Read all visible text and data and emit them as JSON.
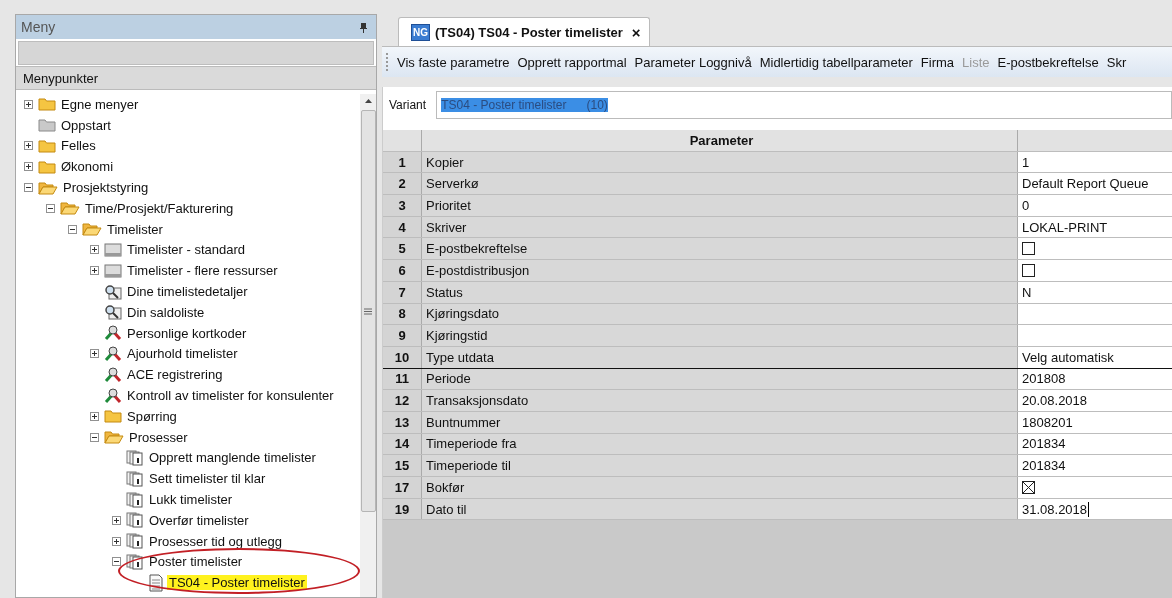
{
  "menu_panel": {
    "title": "Meny",
    "section_title": "Menypunkter"
  },
  "tree": [
    {
      "label": "Egne menyer",
      "kind": "folder",
      "expanded": false,
      "selected": false
    },
    {
      "label": "Oppstart",
      "kind": "folder-grey",
      "selected": false
    },
    {
      "label": "Felles",
      "kind": "folder",
      "expanded": false,
      "selected": false
    },
    {
      "label": "Økonomi",
      "kind": "folder",
      "expanded": false,
      "selected": false
    },
    {
      "label": "Prosjektstyring",
      "kind": "folder-open",
      "expanded": true,
      "selected": false,
      "children": [
        {
          "label": "Time/Prosjekt/Fakturering",
          "kind": "folder-open",
          "expanded": true,
          "selected": false,
          "children": [
            {
              "label": "Timelister",
              "kind": "folder-open",
              "expanded": true,
              "selected": false,
              "children": [
                {
                  "label": "Timelister - standard",
                  "kind": "report",
                  "expanded": false,
                  "selected": false
                },
                {
                  "label": "Timelister - flere ressurser",
                  "kind": "report",
                  "expanded": false,
                  "selected": false
                },
                {
                  "label": "Dine timelistedetaljer",
                  "kind": "search",
                  "selected": false
                },
                {
                  "label": "Din saldoliste",
                  "kind": "search",
                  "selected": false
                },
                {
                  "label": "Personlige kortkoder",
                  "kind": "tools",
                  "selected": false
                },
                {
                  "label": "Ajourhold timelister",
                  "kind": "tools",
                  "expanded": false,
                  "selected": false
                },
                {
                  "label": "ACE registrering",
                  "kind": "tools",
                  "selected": false
                },
                {
                  "label": "Kontroll av timelister for konsulenter",
                  "kind": "tools",
                  "selected": false
                },
                {
                  "label": "Spørring",
                  "kind": "folder",
                  "expanded": false,
                  "selected": false
                },
                {
                  "label": "Prosesser",
                  "kind": "folder-open",
                  "expanded": true,
                  "selected": false,
                  "children": [
                    {
                      "label": "Opprett manglende timelister",
                      "kind": "process",
                      "selected": false
                    },
                    {
                      "label": "Sett timelister til klar",
                      "kind": "process",
                      "selected": false
                    },
                    {
                      "label": "Lukk timelister",
                      "kind": "process",
                      "selected": false
                    },
                    {
                      "label": "Overfør timelister",
                      "kind": "process",
                      "expanded": false,
                      "selected": false
                    },
                    {
                      "label": "Prosesser tid og utlegg",
                      "kind": "process",
                      "expanded": false,
                      "selected": false
                    },
                    {
                      "label": "Poster timelister",
                      "kind": "process",
                      "expanded": true,
                      "selected": false,
                      "children": [
                        {
                          "label": "TS04 - Poster timelister",
                          "kind": "document",
                          "selected": true
                        }
                      ]
                    }
                  ]
                }
              ]
            }
          ]
        }
      ]
    }
  ],
  "tab": {
    "badge": "NG",
    "title": "(TS04) TS04 - Poster timelister",
    "close": "×",
    "selected": true
  },
  "toolbar": [
    {
      "label": "Vis faste parametre",
      "disabled": false
    },
    {
      "label": "Opprett rapportmal",
      "disabled": false
    },
    {
      "label": "Parameter Loggnivå",
      "disabled": false
    },
    {
      "label": "Midlertidig tabellparameter",
      "disabled": false
    },
    {
      "label": "Firma",
      "disabled": false
    },
    {
      "label": "Liste",
      "disabled": true
    },
    {
      "label": "E-postbekreftelse",
      "disabled": false
    },
    {
      "label": "Skr",
      "disabled": false
    }
  ],
  "variant": {
    "label": "Variant",
    "value": "TS04 - Poster timelister      (10)"
  },
  "grid": {
    "columns": [
      "Parameter"
    ],
    "rows": [
      {
        "number": "1",
        "name": "Kopier",
        "kind": "text",
        "value": "1"
      },
      {
        "number": "2",
        "name": "Serverkø",
        "kind": "text",
        "value": "Default Report Queue"
      },
      {
        "number": "3",
        "name": "Prioritet",
        "kind": "text",
        "value": "0"
      },
      {
        "number": "4",
        "name": "Skriver",
        "kind": "text",
        "value": "LOKAL-PRINT"
      },
      {
        "number": "5",
        "name": "E-postbekreftelse",
        "kind": "checkbox",
        "checked": false
      },
      {
        "number": "6",
        "name": "E-postdistribusjon",
        "kind": "checkbox",
        "checked": false
      },
      {
        "number": "7",
        "name": "Status",
        "kind": "text",
        "value": "N"
      },
      {
        "number": "8",
        "name": "Kjøringsdato",
        "kind": "text"
      },
      {
        "number": "9",
        "name": "Kjøringstid",
        "kind": "text"
      },
      {
        "number": "10",
        "name": "Type utdata",
        "kind": "text",
        "value": "Velg automatisk",
        "divider_after": true
      },
      {
        "number": "11",
        "name": "Periode",
        "kind": "text",
        "value": "201808"
      },
      {
        "number": "12",
        "name": "Transaksjonsdato",
        "kind": "text",
        "value": "20.08.2018"
      },
      {
        "number": "13",
        "name": "Buntnummer",
        "kind": "text",
        "value": "1808201"
      },
      {
        "number": "14",
        "name": "Timeperiode fra",
        "kind": "text",
        "value": "201834"
      },
      {
        "number": "15",
        "name": "Timeperiode til",
        "kind": "text",
        "value": "201834"
      },
      {
        "number": "17",
        "name": "Bokfør",
        "kind": "checkbox",
        "checked": true
      },
      {
        "number": "19",
        "name": "Dato til",
        "kind": "text",
        "value": "31.08.2018",
        "editing": true
      }
    ]
  }
}
